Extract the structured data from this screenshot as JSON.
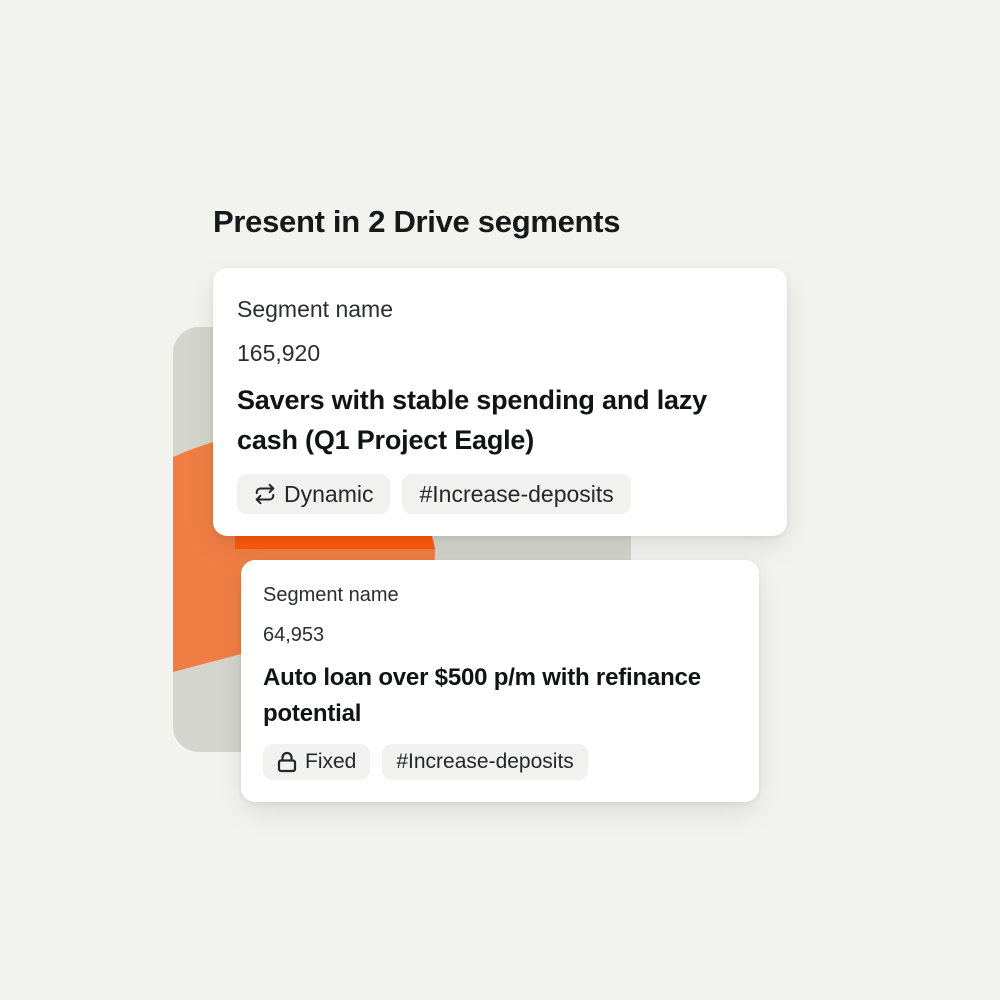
{
  "header": {
    "title": "Present in 2 Drive segments"
  },
  "segments": [
    {
      "label": "Segment name",
      "count": "165,920",
      "title": "Savers with stable spending and lazy cash (Q1 Project Eagle)",
      "type_tag": {
        "icon": "repeat-arrows-icon",
        "label": "Dynamic"
      },
      "hashtag": "#Increase-deposits"
    },
    {
      "label": "Segment name",
      "count": "64,953",
      "title": "Auto loan over $500 p/m with refinance potential",
      "type_tag": {
        "icon": "lock-icon",
        "label": "Fixed"
      },
      "hashtag": "#Increase-deposits"
    }
  ],
  "colors": {
    "background": "#f2f2ee",
    "decor_panel": "#d4d5cc",
    "accent_orange": "#f07e44",
    "accent_orange_bright": "#ff5a0a"
  }
}
